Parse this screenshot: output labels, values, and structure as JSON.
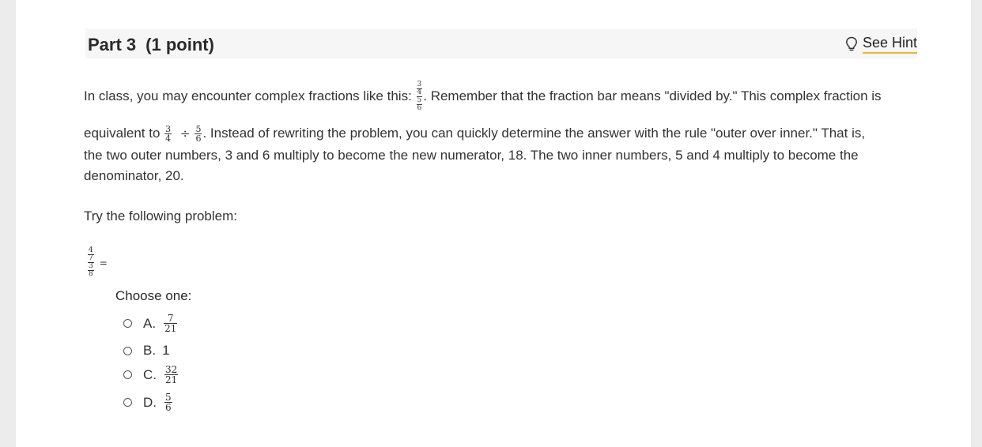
{
  "part": {
    "title": "Part 3",
    "points": "(1 point)"
  },
  "hint": {
    "label": "See Hint",
    "icon": "lightbulb-icon"
  },
  "intro": {
    "line1_a": "In class, you may encounter complex fractions like this: ",
    "example_complex": {
      "top_num": "3",
      "top_den": "4",
      "bot_num": "5",
      "bot_den": "6"
    },
    "line1_b": ". Remember that the fraction bar means \"divided by.\" This complex fraction is",
    "line2_a": "equivalent to ",
    "equiv": {
      "a_num": "3",
      "a_den": "4",
      "op": "÷",
      "b_num": "5",
      "b_den": "6"
    },
    "line2_b": ". Instead of rewriting the problem, you can quickly determine the answer with the rule \"outer over inner.\" That is,",
    "line3": "the two outer numbers, 3 and 6 multiply to become the new numerator, 18. The two inner numbers, 5 and 4 multiply to become the",
    "line4": "denominator, 20."
  },
  "prompt": "Try the following problem:",
  "problem": {
    "top_num": "4",
    "top_den": "7",
    "bot_num": "3",
    "bot_den": "8",
    "equals": "="
  },
  "choose_label": "Choose one:",
  "options": [
    {
      "letter": "A.",
      "num": "7",
      "den": "21",
      "text": ""
    },
    {
      "letter": "B.",
      "num": "",
      "den": "",
      "text": "1"
    },
    {
      "letter": "C.",
      "num": "32",
      "den": "21",
      "text": ""
    },
    {
      "letter": "D.",
      "num": "5",
      "den": "6",
      "text": ""
    }
  ]
}
